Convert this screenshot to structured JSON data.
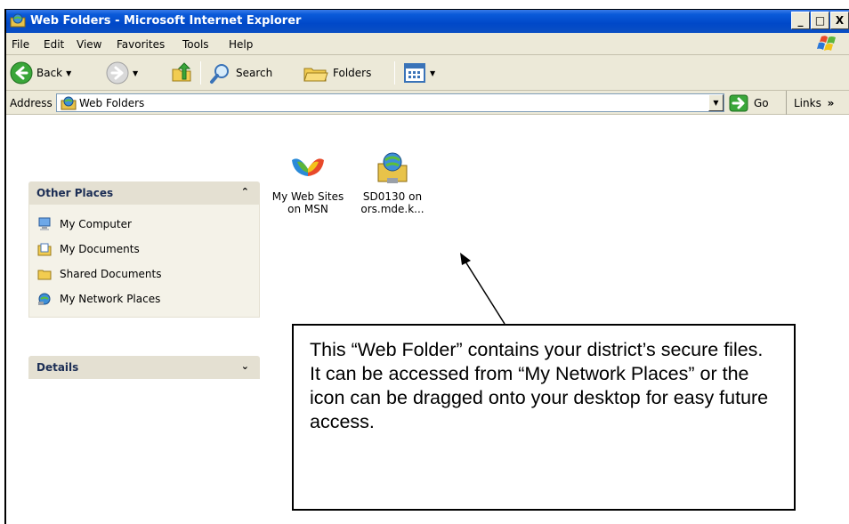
{
  "window": {
    "title": "Web Folders - Microsoft Internet Explorer",
    "controls": {
      "minimize": "_",
      "maximize": "□",
      "close": "X"
    }
  },
  "menu": [
    "File",
    "Edit",
    "View",
    "Favorites",
    "Tools",
    "Help"
  ],
  "toolbar": {
    "back": "Back",
    "search": "Search",
    "folders": "Folders"
  },
  "address": {
    "label": "Address",
    "value": "Web Folders",
    "go": "Go",
    "links": "Links"
  },
  "sidebar": {
    "other_places": {
      "title": "Other Places",
      "items": [
        {
          "label": "My Computer",
          "icon": "computer-icon"
        },
        {
          "label": "My Documents",
          "icon": "documents-icon"
        },
        {
          "label": "Shared Documents",
          "icon": "folder-icon"
        },
        {
          "label": "My Network Places",
          "icon": "network-places-icon"
        }
      ]
    },
    "details": {
      "title": "Details"
    }
  },
  "files": [
    {
      "label_line1": "My Web Sites",
      "label_line2": "on MSN",
      "icon": "msn-butterfly-icon"
    },
    {
      "label_line1": "SD0130 on",
      "label_line2": "ors.mde.k...",
      "icon": "web-folder-icon"
    }
  ],
  "callout": {
    "text": "This “Web Folder” contains your district’s secure files. It can be accessed from “My Network Places” or the icon can be dragged onto your desktop for easy future access."
  }
}
